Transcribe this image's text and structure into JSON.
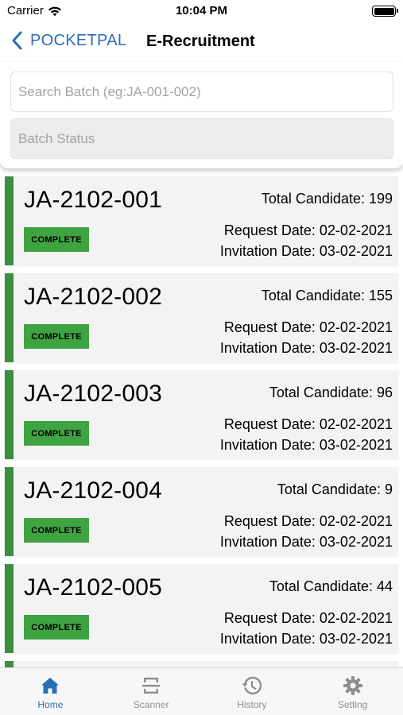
{
  "status_bar": {
    "carrier": "Carrier",
    "time": "10:04 PM"
  },
  "nav": {
    "back_label": "POCKETPAL",
    "title": "E-Recruitment"
  },
  "search": {
    "batch_placeholder": "Search Batch (eg:JA-001-002)",
    "status_placeholder": "Batch Status"
  },
  "colors": {
    "accent": "#2a6fb4",
    "complete": "#3fa342",
    "card_border": "#3b8f3e"
  },
  "batches": [
    {
      "id": "JA-2102-001",
      "status": "COMPLETE",
      "total": "Total Candidate: 199",
      "request": "Request Date: 02-02-2021",
      "invitation": "Invitation Date: 03-02-2021"
    },
    {
      "id": "JA-2102-002",
      "status": "COMPLETE",
      "total": "Total Candidate: 155",
      "request": "Request Date: 02-02-2021",
      "invitation": "Invitation Date: 03-02-2021"
    },
    {
      "id": "JA-2102-003",
      "status": "COMPLETE",
      "total": "Total Candidate: 96",
      "request": "Request Date: 02-02-2021",
      "invitation": "Invitation Date: 03-02-2021"
    },
    {
      "id": "JA-2102-004",
      "status": "COMPLETE",
      "total": "Total Candidate: 9",
      "request": "Request Date: 02-02-2021",
      "invitation": "Invitation Date: 03-02-2021"
    },
    {
      "id": "JA-2102-005",
      "status": "COMPLETE",
      "total": "Total Candidate: 44",
      "request": "Request Date: 02-02-2021",
      "invitation": "Invitation Date: 03-02-2021"
    }
  ],
  "tabs": [
    {
      "label": "Home",
      "icon": "home-icon",
      "active": true
    },
    {
      "label": "Scanner",
      "icon": "scanner-icon",
      "active": false
    },
    {
      "label": "History",
      "icon": "history-icon",
      "active": false
    },
    {
      "label": "Setting",
      "icon": "gear-icon",
      "active": false
    }
  ]
}
